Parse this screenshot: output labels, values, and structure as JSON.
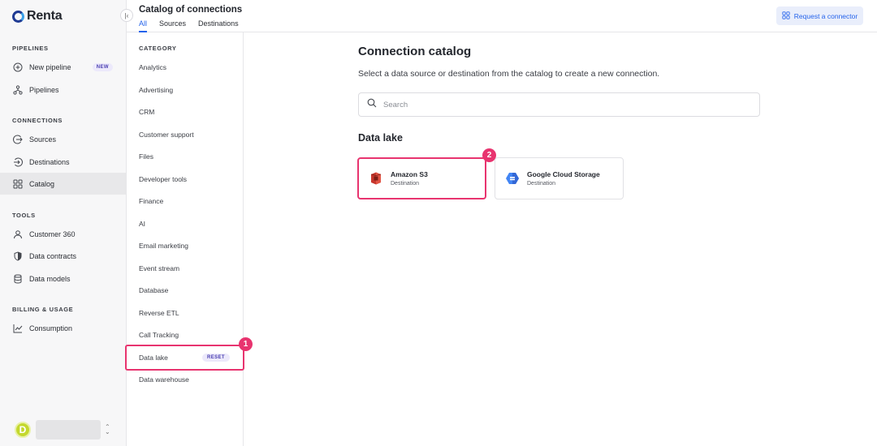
{
  "app": {
    "name": "Renta"
  },
  "sidebar": {
    "sections": [
      {
        "title": "PIPELINES"
      },
      {
        "title": "CONNECTIONS"
      },
      {
        "title": "TOOLS"
      },
      {
        "title": "BILLING & USAGE"
      }
    ],
    "items": [
      {
        "label": "New pipeline",
        "icon": "plus-circle-icon",
        "badge": "NEW"
      },
      {
        "label": "Pipelines",
        "icon": "pipeline-icon"
      },
      {
        "label": "Sources",
        "icon": "source-icon"
      },
      {
        "label": "Destinations",
        "icon": "destination-icon"
      },
      {
        "label": "Catalog",
        "icon": "grid-icon",
        "active": true
      },
      {
        "label": "Customer 360",
        "icon": "user-icon"
      },
      {
        "label": "Data contracts",
        "icon": "shield-icon"
      },
      {
        "label": "Data models",
        "icon": "database-icon"
      },
      {
        "label": "Consumption",
        "icon": "chart-icon"
      }
    ],
    "user": {
      "avatar_letter": "D"
    }
  },
  "header": {
    "title": "Catalog of connections",
    "tabs": [
      {
        "label": "All",
        "active": true
      },
      {
        "label": "Sources"
      },
      {
        "label": "Destinations"
      }
    ],
    "request_button": "Request a connector"
  },
  "category": {
    "heading": "CATEGORY",
    "items": [
      "Analytics",
      "Advertising",
      "CRM",
      "Customer support",
      "Files",
      "Developer tools",
      "Finance",
      "AI",
      "Email marketing",
      "Event stream",
      "Database",
      "Reverse ETL",
      "Call Tracking",
      "Data lake",
      "Data warehouse"
    ],
    "selected": "Data lake",
    "reset_label": "RESET"
  },
  "main": {
    "title": "Connection catalog",
    "subtitle": "Select a data source or destination from the catalog to create a new connection.",
    "search_placeholder": "Search",
    "section": "Data lake",
    "cards": [
      {
        "name": "Amazon S3",
        "type": "Destination"
      },
      {
        "name": "Google Cloud Storage",
        "type": "Destination"
      }
    ]
  },
  "markers": [
    "1",
    "2"
  ],
  "colors": {
    "accent": "#2463eb",
    "highlight": "#e8346f",
    "badge_bg": "#ece9fb"
  }
}
